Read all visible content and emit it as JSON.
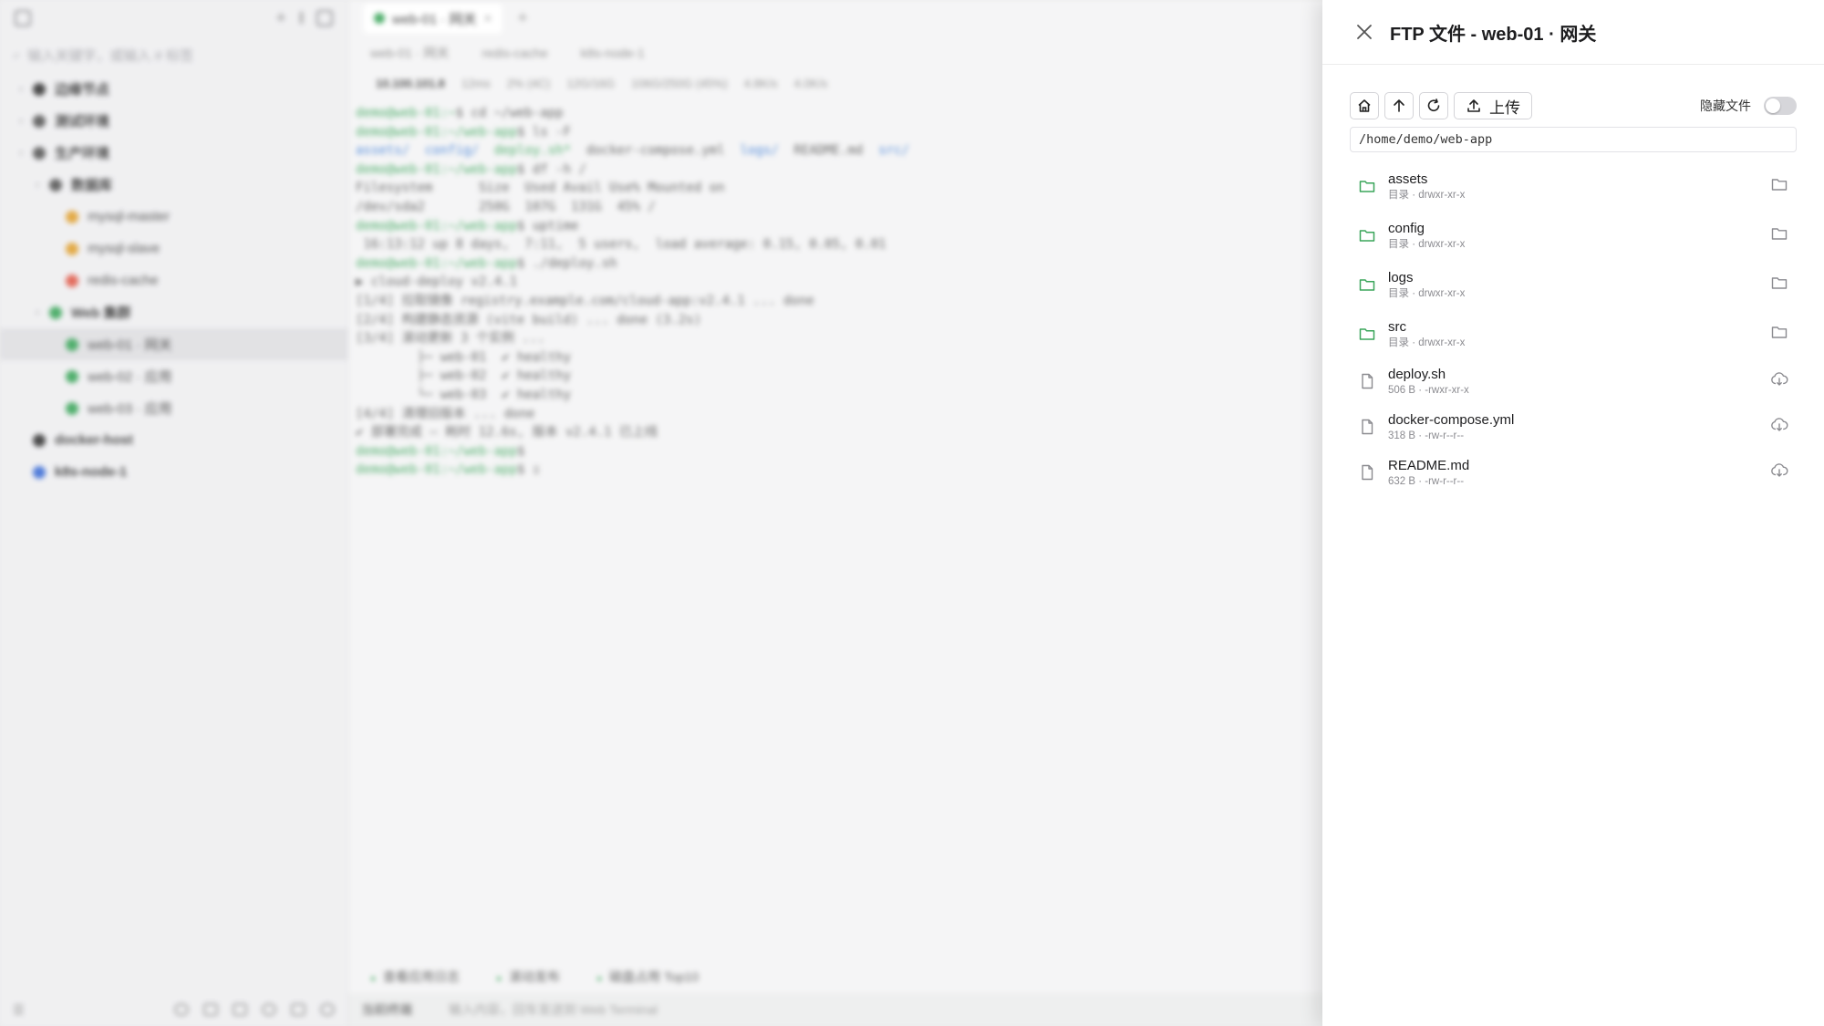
{
  "background": {
    "sidebar": {
      "search_placeholder": "输入关键字，或输入 # 标签",
      "tree": [
        {
          "label": "边缘节点",
          "level": 0,
          "color": "#333333"
        },
        {
          "label": "测试环境",
          "level": 0,
          "color": "#555555"
        },
        {
          "label": "生产环境",
          "level": 0,
          "color": "#555555"
        },
        {
          "label": "数据库",
          "level": 1,
          "color": "#555555"
        },
        {
          "label": "mysql-master",
          "level": 2,
          "color": "#e0a030"
        },
        {
          "label": "mysql-slave",
          "level": 2,
          "color": "#e0a030"
        },
        {
          "label": "redis-cache",
          "level": 2,
          "color": "#e05a4a"
        },
        {
          "label": "Web 集群",
          "level": 1,
          "color": "#3aa55a"
        },
        {
          "label": "web-01 · 网关",
          "level": 2,
          "color": "#3aa55a",
          "selected": true
        },
        {
          "label": "web-02 · 应用",
          "level": 2,
          "color": "#3aa55a"
        },
        {
          "label": "web-03 · 应用",
          "level": 2,
          "color": "#3aa55a"
        },
        {
          "label": "docker-host",
          "level": 0,
          "color": "#333333"
        },
        {
          "label": "k8s-node-1",
          "level": 0,
          "color": "#3a6bd5"
        }
      ]
    },
    "main": {
      "active_tab": "web-01 · 网关",
      "subtabs": [
        "web-01 · 网关",
        "redis-cache",
        "k8s-node-1"
      ],
      "status": {
        "host": "10.100.101.8",
        "latency": "12ms",
        "cpu": "2% (4C)",
        "mem": "12G/16G",
        "disk": "106G/250G (45%)",
        "down": "4.8K/s",
        "up": "4.0K/s"
      },
      "terminal_lines": [
        [
          {
            "c": "p",
            "t": "demo@web-01:~"
          },
          {
            "c": "",
            "t": "$ cd ~/web-app"
          }
        ],
        [
          {
            "c": "p",
            "t": "demo@web-01:~/web-app"
          },
          {
            "c": "",
            "t": "$ ls -F"
          }
        ],
        [
          {
            "c": "d",
            "t": "assets/"
          },
          {
            "c": "",
            "t": "  "
          },
          {
            "c": "d",
            "t": "config/"
          },
          {
            "c": "",
            "t": "  "
          },
          {
            "c": "p",
            "t": "deploy.sh*"
          },
          {
            "c": "",
            "t": "  docker-compose.yml  "
          },
          {
            "c": "d",
            "t": "logs/"
          },
          {
            "c": "",
            "t": "  README.md  "
          },
          {
            "c": "d",
            "t": "src/"
          }
        ],
        [
          {
            "c": "p",
            "t": "demo@web-01:~/web-app"
          },
          {
            "c": "",
            "t": "$ df -h /"
          }
        ],
        [
          {
            "c": "",
            "t": "Filesystem      Size  Used Avail Use% Mounted on"
          }
        ],
        [
          {
            "c": "",
            "t": "/dev/sda2       250G  107G  131G  45% /"
          }
        ],
        [
          {
            "c": "p",
            "t": "demo@web-01:~/web-app"
          },
          {
            "c": "",
            "t": "$ uptime"
          }
        ],
        [
          {
            "c": "",
            "t": " 16:13:12 up 8 days,  7:11,  5 users,  load average: 0.15, 0.05, 0.01"
          }
        ],
        [
          {
            "c": "p",
            "t": "demo@web-01:~/web-app"
          },
          {
            "c": "",
            "t": "$ ./deploy.sh"
          }
        ],
        [
          {
            "c": "",
            "t": "▶ cloud-deploy v2.4.1"
          }
        ],
        [
          {
            "c": "",
            "t": "[1/4] 拉取镜像 registry.example.com/cloud-app:v2.4.1 ... done"
          }
        ],
        [
          {
            "c": "",
            "t": "[2/4] 构建静态资源 (vite build) ... done (3.2s)"
          }
        ],
        [
          {
            "c": "",
            "t": "[3/4] 滚动更新 3 个实例 ..."
          }
        ],
        [
          {
            "c": "",
            "t": "        ├─ web-01  ✔ healthy"
          }
        ],
        [
          {
            "c": "",
            "t": "        ├─ web-02  ✔ healthy"
          }
        ],
        [
          {
            "c": "",
            "t": "        └─ web-03  ✔ healthy"
          }
        ],
        [
          {
            "c": "",
            "t": "[4/4] 清理旧版本 ... done"
          }
        ],
        [
          {
            "c": "",
            "t": "✔ 部署完成 — 耗时 12.6s, 版本 v2.4.1 已上线"
          }
        ],
        [
          {
            "c": "p",
            "t": "demo@web-01:~/web-app"
          },
          {
            "c": "",
            "t": "$"
          }
        ],
        [
          {
            "c": "p",
            "t": "demo@web-01:~/web-app"
          },
          {
            "c": "",
            "t": "$ ▯"
          }
        ]
      ],
      "quick_commands": [
        "查看应用日志",
        "滚动发布",
        "磁盘占用 Top10"
      ],
      "input_target": "当前终端",
      "input_placeholder": "输入内容，回车发送到 Web Terminal"
    }
  },
  "drawer": {
    "title": "FTP 文件 - web-01 · 网关",
    "upload_label": "上传",
    "hidden_files_label": "隐藏文件",
    "hidden_files_on": false,
    "path": "/home/demo/web-app",
    "entries": [
      {
        "name": "assets",
        "meta": "目录 · drwxr-xr-x",
        "type": "dir"
      },
      {
        "name": "config",
        "meta": "目录 · drwxr-xr-x",
        "type": "dir"
      },
      {
        "name": "logs",
        "meta": "目录 · drwxr-xr-x",
        "type": "dir"
      },
      {
        "name": "src",
        "meta": "目录 · drwxr-xr-x",
        "type": "dir"
      },
      {
        "name": "deploy.sh",
        "meta": "506 B · -rwxr-xr-x",
        "type": "file"
      },
      {
        "name": "docker-compose.yml",
        "meta": "318 B · -rw-r--r--",
        "type": "file"
      },
      {
        "name": "README.md",
        "meta": "632 B · -rw-r--r--",
        "type": "file"
      }
    ],
    "colors": {
      "folder": "#3aa55a",
      "muted": "#8b8b90"
    }
  }
}
